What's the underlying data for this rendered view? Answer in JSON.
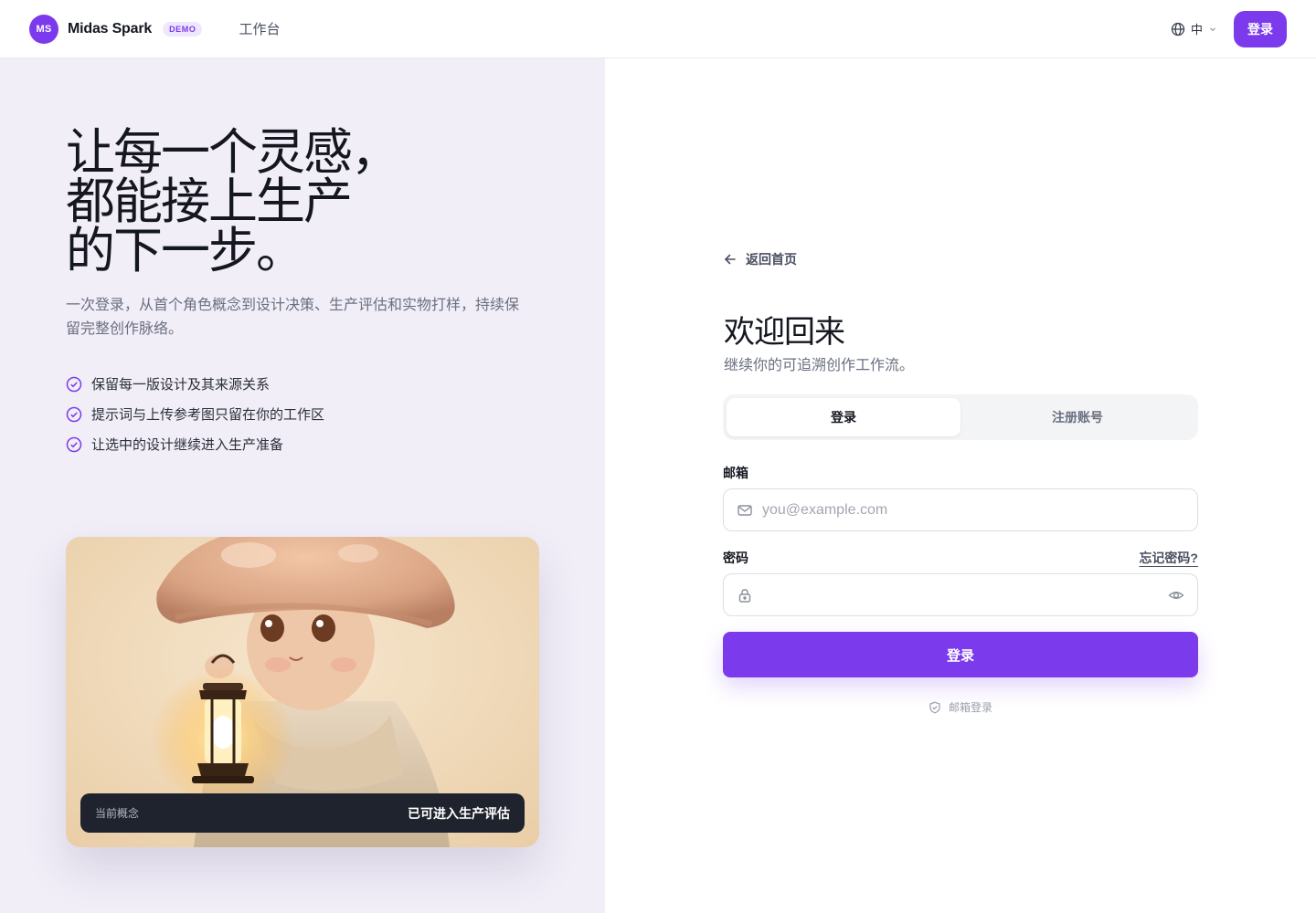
{
  "header": {
    "logo_initials": "MS",
    "brand": "Midas Spark",
    "badge": "DEMO",
    "nav_workspace": "工作台",
    "lang": "中",
    "login_button": "登录"
  },
  "hero": {
    "headline": [
      "让每一个灵感，",
      "都能接上生产",
      "的下一步。"
    ],
    "subtext": "一次登录，从首个角色概念到设计决策、生产评估和实物打样，持续保留完整创作脉络。",
    "features": [
      "保留每一版设计及其来源关系",
      "提示词与上传参考图只留在你的工作区",
      "让选中的设计继续进入生产准备"
    ],
    "card": {
      "label": "当前概念",
      "status": "已可进入生产评估"
    }
  },
  "auth": {
    "back": "返回首页",
    "title": "欢迎回来",
    "subtitle": "继续你的可追溯创作工作流。",
    "tabs": [
      "登录",
      "注册账号"
    ],
    "email_label": "邮箱",
    "email_placeholder": "you@example.com",
    "password_label": "密码",
    "forgot": "忘记密码?",
    "submit": "登录",
    "method": "邮箱登录"
  },
  "colors": {
    "accent": "#7c3aed",
    "left_panel_bg": "#f1eef8",
    "card_footer_bg": "#1f232d"
  },
  "icons": {
    "language": "globe-icon",
    "lang_dropdown": "chevron-down-icon",
    "feature": "check-circle-icon",
    "back": "arrow-left-icon",
    "email": "mail-icon",
    "password": "lock-icon",
    "reveal": "eye-icon",
    "method": "shield-check-icon"
  }
}
